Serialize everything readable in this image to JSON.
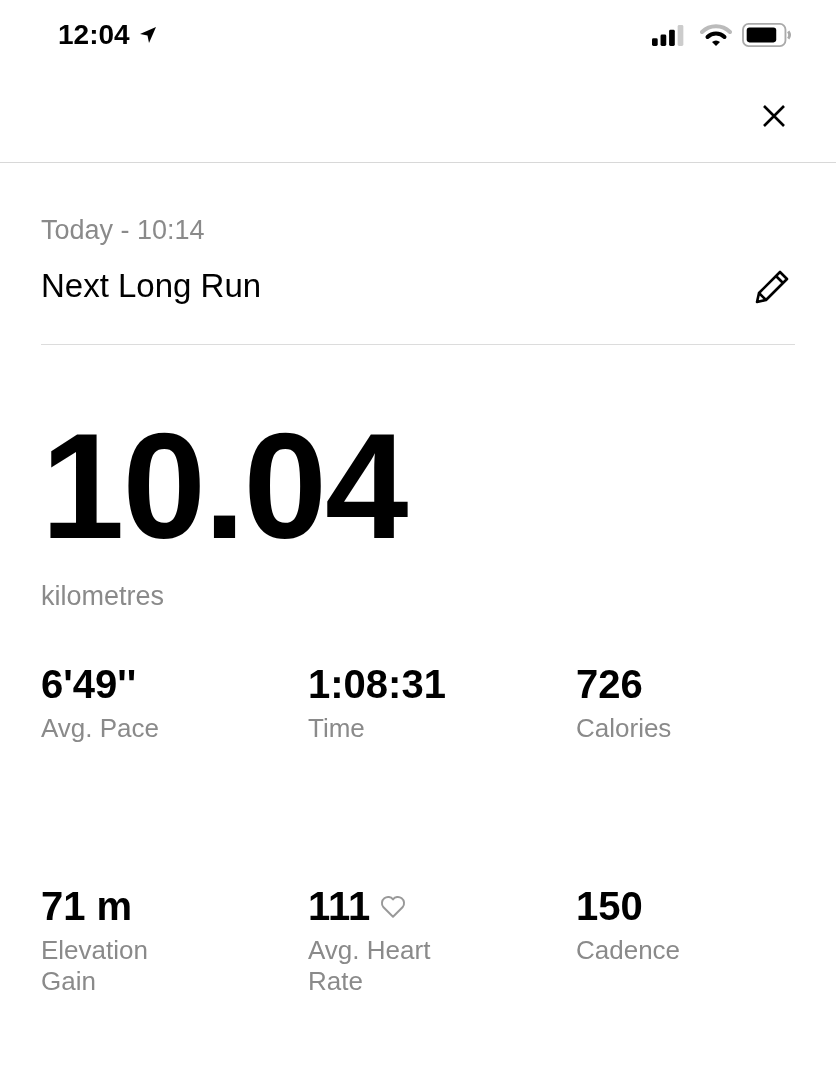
{
  "status_bar": {
    "time": "12:04"
  },
  "date": "Today - 10:14",
  "title": "Next Long Run",
  "distance": {
    "value": "10.04",
    "unit": "kilometres"
  },
  "stats": [
    {
      "value": "6'49''",
      "label": "Avg. Pace",
      "kind": "plain"
    },
    {
      "value": "1:08:31",
      "label": "Time",
      "kind": "plain"
    },
    {
      "value": "726",
      "label": "Calories",
      "kind": "plain"
    },
    {
      "value": "71 m",
      "label": "Elevation Gain",
      "kind": "plain"
    },
    {
      "value": "111",
      "label": "Avg. Heart Rate",
      "kind": "heart"
    },
    {
      "value": "150",
      "label": "Cadence",
      "kind": "plain"
    }
  ]
}
